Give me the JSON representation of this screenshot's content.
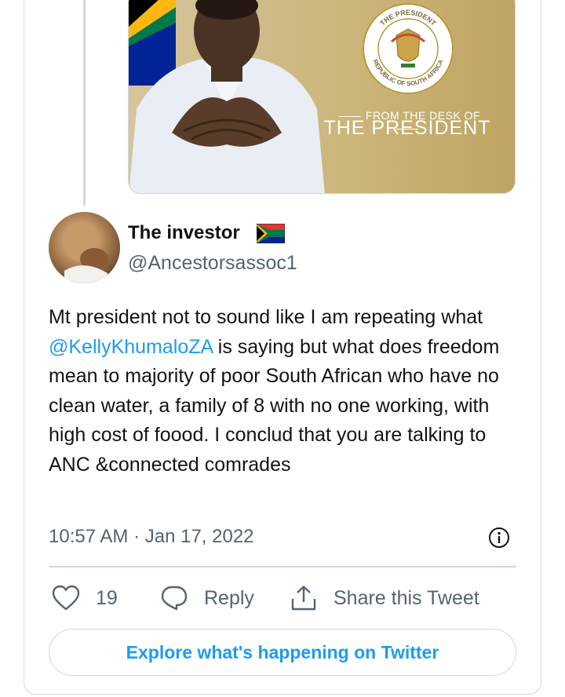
{
  "media": {
    "caption_top": "FROM THE DESK OF",
    "caption_title": "THE PRESIDENT",
    "seal_top_text": "THE PRESIDENT",
    "seal_bottom_text": "REPUBLIC OF SOUTH AFRICA"
  },
  "author": {
    "display_name": "The investor",
    "handle": "@Ancestorsassoc1"
  },
  "tweet": {
    "text_before": "Mt president not to sound like I am repeating what ",
    "mention": "@KellyKhumaloZA",
    "text_after": " is saying but what does freedom mean to majority of poor South African who have no clean water, a family of 8 with no one working, with high cost of foood. I conclud that you are talking to ANC &connected comrades",
    "timestamp": "10:57 AM · Jan 17, 2022"
  },
  "actions": {
    "like_count": "19",
    "reply_label": "Reply",
    "share_label": "Share this Tweet"
  },
  "explore": {
    "label": "Explore what's happening on Twitter"
  },
  "colors": {
    "accent": "#1d9bf0",
    "secondary_text": "#536471",
    "border": "#cfd9de"
  },
  "icons": [
    "heart-icon",
    "reply-bubble-icon",
    "share-icon",
    "info-icon",
    "south-africa-flag-icon"
  ]
}
